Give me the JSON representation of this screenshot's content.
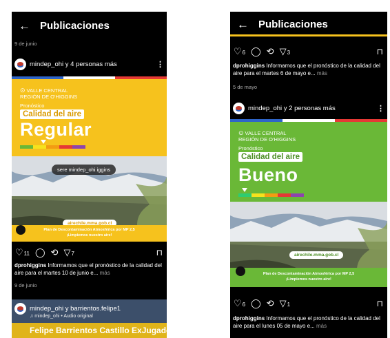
{
  "left": {
    "header": {
      "title": "Publicaciones",
      "back_glyph": "←"
    },
    "date_top": "9 de junio",
    "post": {
      "user_text": "mindep_ohi y 4 personas más",
      "region": "VALLE CENTRAL\nREGIÓN DE O'HIGGINS",
      "pronostico": "Pronóstico",
      "calidad": "Calidad del aire",
      "level": "Regular",
      "tag": "sere   mindep_ohi   iggins",
      "url": "airechile.mma.gob.cl",
      "plan_line1": "Plan de Descontaminación Atmosférica por MP 2,5",
      "plan_line2": "¡Limpiemos nuestro aire!",
      "likes": "11",
      "shares": "7",
      "caption_user": "dprohiggins",
      "caption_text": " Informamos que el pronóstico de la calidad del aire para el martes 10 de junio e...",
      "more": " más",
      "date": "9 de junio"
    },
    "reel": {
      "user_text": "mindep_ohi y barrientos.felipe1",
      "audio": "♫ mindep_ohi • Audio original",
      "title": "Felipe Barrientos Castillo ExJugador"
    }
  },
  "right": {
    "header": {
      "title": "Publicaciones",
      "back_glyph": "←"
    },
    "prev_actions": {
      "likes": "6",
      "shares": "3"
    },
    "prev_caption": {
      "user": "dprohiggins",
      "text": " Informamos que el pronóstico de la calidad del aire para el martes 6 de mayo e...",
      "more": " más",
      "date": "5 de mayo"
    },
    "post": {
      "user_text": "mindep_ohi y 2 personas más",
      "region": "VALLE CENTRAL\nREGIÓN DE O'HIGGINS",
      "pronostico": "Pronóstico",
      "calidad": "Calidad del aire",
      "level": "Bueno",
      "url": "airechile.mma.gob.cl",
      "plan_line1": "Plan de Descontaminación Atmosférica por MP 2,5",
      "plan_line2": "¡Limpiemos nuestro aire!",
      "likes": "6",
      "shares": "1",
      "caption_user": "dprohiggins",
      "caption_text": " Informamos que el pronóstico de la calidad del aire para el lunes 05 de mayo e...",
      "more": " más"
    }
  },
  "colors": {
    "yellow": "#f6c21d",
    "green": "#6ab837",
    "red": "#e53935",
    "orange": "#f39c12",
    "purple": "#8e44ad",
    "blue": "#2e64c8"
  }
}
